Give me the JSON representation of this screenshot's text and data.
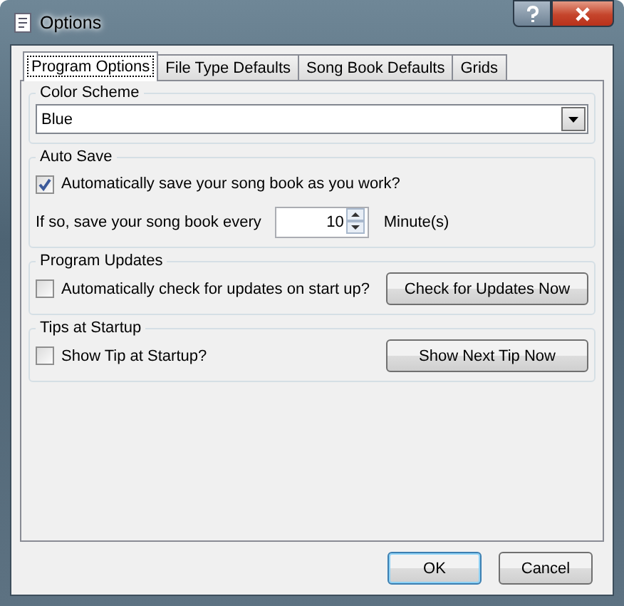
{
  "window": {
    "title": "Options"
  },
  "tabs": [
    {
      "label": "Program Options",
      "selected": true
    },
    {
      "label": "File Type Defaults",
      "selected": false
    },
    {
      "label": "Song Book Defaults",
      "selected": false
    },
    {
      "label": "Grids",
      "selected": false
    }
  ],
  "color_scheme": {
    "legend": "Color Scheme",
    "value": "Blue"
  },
  "auto_save": {
    "legend": "Auto Save",
    "checkbox": {
      "label": "Automatically save your song book as you work?",
      "checked": true
    },
    "interval_label": "If so, save your song book every",
    "interval_value": "10",
    "unit": "Minute(s)"
  },
  "program_updates": {
    "legend": "Program Updates",
    "checkbox": {
      "label": "Automatically check for updates on start up?",
      "checked": false
    },
    "button": "Check for Updates Now"
  },
  "tips": {
    "legend": "Tips at Startup",
    "checkbox": {
      "label": "Show Tip at Startup?",
      "checked": false
    },
    "button": "Show Next Tip Now"
  },
  "buttons": [
    {
      "label": "OK",
      "kind": "default"
    },
    {
      "label": "Cancel",
      "kind": "normal"
    }
  ]
}
